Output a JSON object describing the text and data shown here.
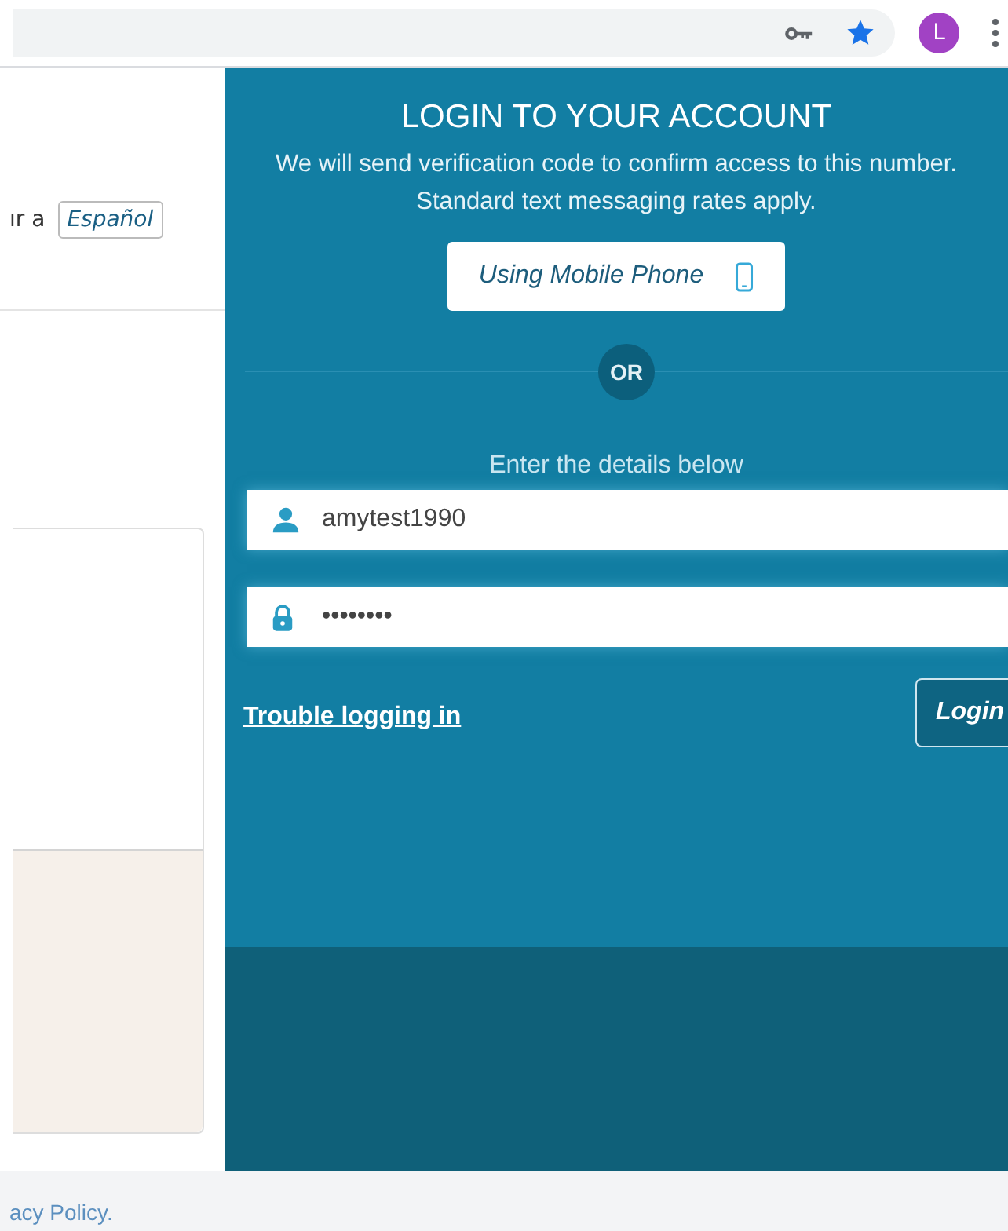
{
  "browser": {
    "avatar_letter": "L"
  },
  "page": {
    "language_prompt": "ır a",
    "language_button": "Español",
    "footer_link": "acy Policy."
  },
  "login": {
    "title": "LOGIN TO YOUR ACCOUNT",
    "message": [
      "We will send verification code to confirm access to this number.",
      "Standard text messaging rates apply."
    ],
    "mobile_button": "Using Mobile Phone",
    "divider": "OR",
    "details_prompt": "Enter the details below",
    "username": {
      "value": "amytest1990"
    },
    "password": {
      "value": "••••••••"
    },
    "trouble_link": "Trouble logging in",
    "login_button": "Login"
  }
}
